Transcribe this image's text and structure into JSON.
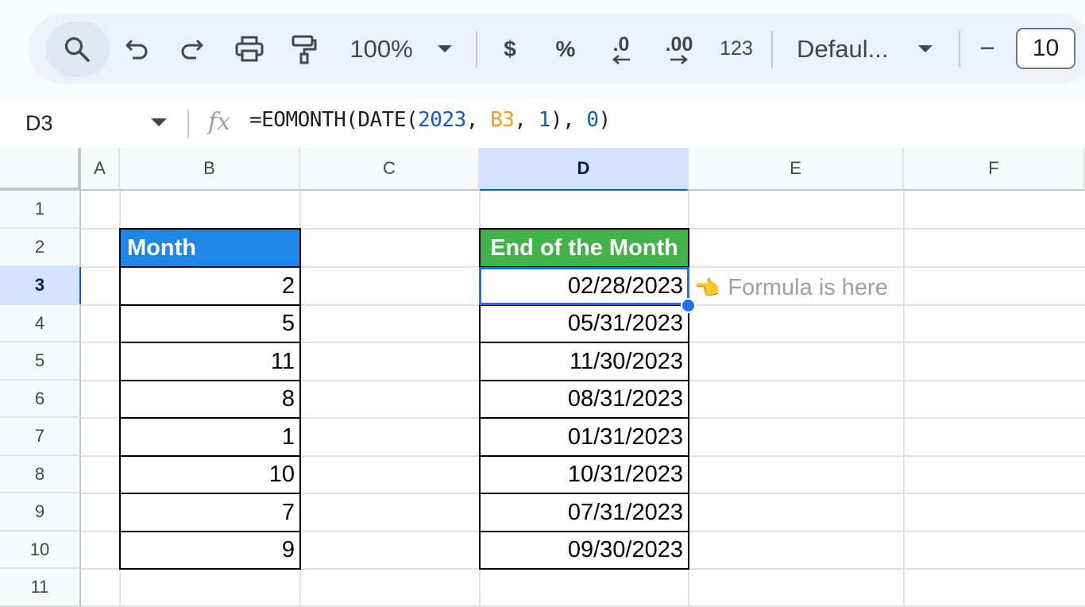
{
  "toolbar": {
    "zoom": "100%",
    "currency": "$",
    "percent": "%",
    "decrease_decimal": ".0",
    "increase_decimal": ".00",
    "number_format": "123",
    "font_name": "Defaul...",
    "font_size_minus": "−",
    "font_size": "10"
  },
  "formula_bar": {
    "cell_ref": "D3",
    "fx": "fx",
    "formula_prefix": "=EOMONTH(DATE(",
    "arg_year": "2023",
    "sep1": ", ",
    "arg_ref": "B3",
    "sep2": ", ",
    "arg_day": "1",
    "sep3": "), ",
    "arg_offset": "0",
    "formula_suffix": ")"
  },
  "columns": [
    "A",
    "B",
    "C",
    "D",
    "E",
    "F"
  ],
  "rows": [
    "1",
    "2",
    "3",
    "4",
    "5",
    "6",
    "7",
    "8",
    "9",
    "10",
    "11"
  ],
  "selected_column": "D",
  "selected_row": "3",
  "table": {
    "month_header": "Month",
    "end_header": "End of the Month",
    "months": [
      "2",
      "5",
      "11",
      "8",
      "1",
      "10",
      "7",
      "9"
    ],
    "end_dates": [
      "02/28/2023",
      "05/31/2023",
      "11/30/2023",
      "08/31/2023",
      "01/31/2023",
      "10/31/2023",
      "07/31/2023",
      "09/30/2023"
    ]
  },
  "annotation": {
    "hand_icon": "👈",
    "text": "Formula is here"
  },
  "colors": {
    "month_header_bg": "#1f87e5",
    "end_header_bg": "#41b349",
    "selection": "#1a73e8"
  }
}
